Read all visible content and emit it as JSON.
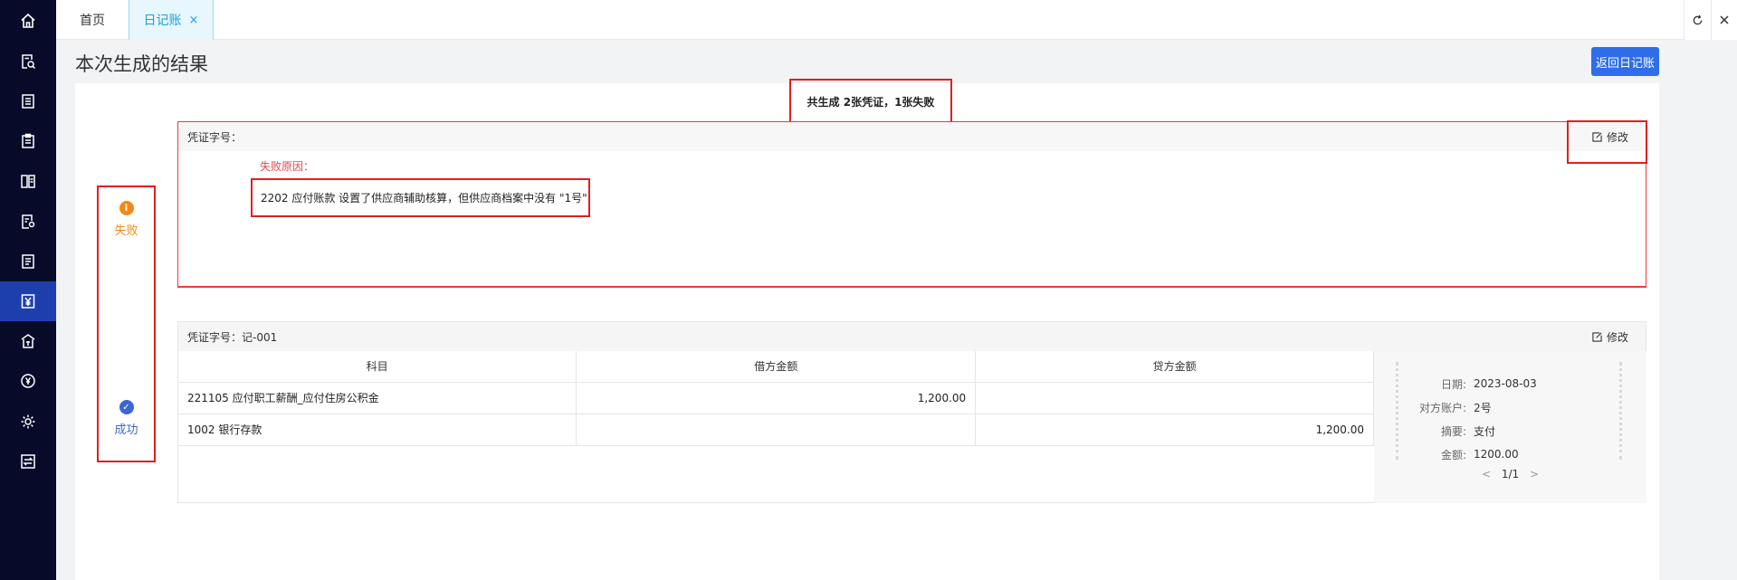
{
  "sidebar": {
    "items": [
      {
        "icon": "home-icon"
      },
      {
        "icon": "document-search-icon"
      },
      {
        "icon": "list-document-icon"
      },
      {
        "icon": "clipboard-icon"
      },
      {
        "icon": "book-icon"
      },
      {
        "icon": "document-settings-icon"
      },
      {
        "icon": "ledger-icon"
      },
      {
        "icon": "yen-document-icon",
        "active": true
      },
      {
        "icon": "bank-icon"
      },
      {
        "icon": "yen-circle-icon"
      },
      {
        "icon": "gear-icon"
      },
      {
        "icon": "transfer-icon"
      }
    ],
    "bg_color": "#070b29",
    "active_color": "#1d3fae"
  },
  "tabs": {
    "home": "首页",
    "active": "日记账",
    "close": "×"
  },
  "page": {
    "title": "本次生成的结果",
    "back_button": "返回日记账"
  },
  "summary": "共生成 2张凭证，1张失败",
  "status": {
    "fail_label": "失败",
    "fail_icon": "i",
    "success_label": "成功",
    "success_icon": "✓"
  },
  "voucher_failed": {
    "number_label": "凭证字号：",
    "edit_label": "修改",
    "fail_reason_label": "失败原因：",
    "fail_reason": "2202 应付账款 设置了供应商辅助核算，但供应商档案中没有 \"1号\""
  },
  "voucher_success": {
    "number_label": "凭证字号：记-001",
    "edit_label": "修改",
    "headers": [
      "科目",
      "借方金额",
      "贷方金额"
    ],
    "rows": [
      {
        "subject": "221105 应付职工薪酬_应付住房公积金",
        "debit": "1,200.00",
        "credit": ""
      },
      {
        "subject": "1002 银行存款",
        "debit": "",
        "credit": "1,200.00"
      }
    ],
    "info": {
      "date_label": "日期:",
      "date": "2023-08-03",
      "account_label": "对方账户:",
      "account": "2号",
      "memo_label": "摘要:",
      "memo": "支付",
      "amount_label": "金额:",
      "amount": "1200.00"
    },
    "pager": {
      "prev": "<",
      "text": "1/1",
      "next": ">"
    }
  },
  "colors": {
    "accent": "#2f6ee8",
    "highlight_border": "#e0201e",
    "fail": "#f08a17",
    "success": "#3b66d6",
    "fail_reason": "#e8454a"
  }
}
